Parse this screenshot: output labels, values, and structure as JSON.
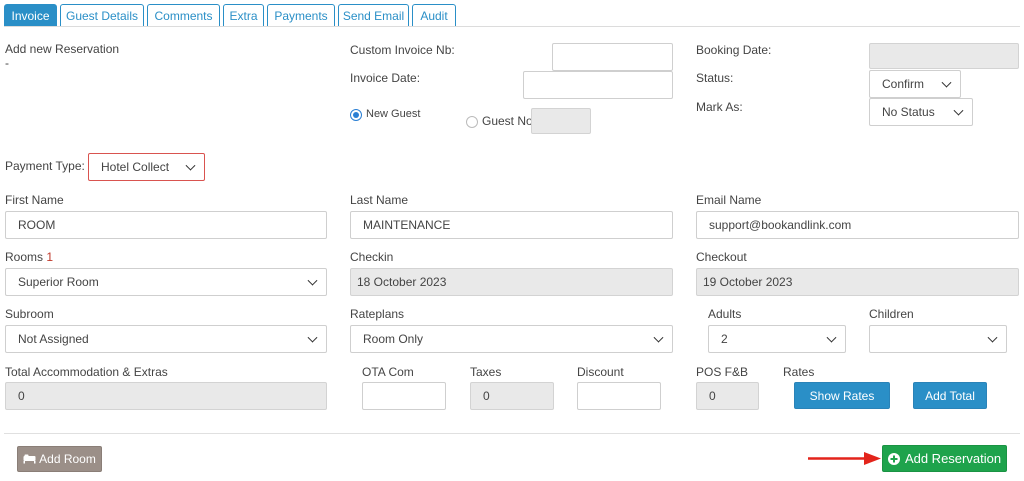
{
  "tabs": [
    "Invoice",
    "Guest Details",
    "Comments",
    "Extra",
    "Payments",
    "Send Email",
    "Audit"
  ],
  "header": {
    "title": "Add new Reservation",
    "subtitle": "-"
  },
  "invoice": {
    "custom_invoice_label": "Custom Invoice Nb:",
    "custom_invoice_value": "",
    "invoice_date_label": "Invoice Date:",
    "invoice_date_value": "",
    "new_guest_label": "New Guest",
    "guest_no_label": "Guest No",
    "guest_no_value": ""
  },
  "booking": {
    "booking_date_label": "Booking Date:",
    "booking_date_value": "",
    "status_label": "Status:",
    "status_value": "Confirm",
    "mark_as_label": "Mark As:",
    "mark_as_value": "No Status"
  },
  "payment": {
    "label": "Payment Type:",
    "value": "Hotel Collect"
  },
  "guest": {
    "first_name_label": "First Name",
    "first_name_value": "ROOM",
    "last_name_label": "Last Name",
    "last_name_value": "MAINTENANCE",
    "email_label": "Email Name",
    "email_value": "support@bookandlink.com"
  },
  "stay": {
    "rooms_label": "Rooms",
    "rooms_count": "1",
    "rooms_value": "Superior Room",
    "checkin_label": "Checkin",
    "checkin_value": "18 October 2023",
    "checkout_label": "Checkout",
    "checkout_value": "19 October 2023",
    "subroom_label": "Subroom",
    "subroom_value": "Not Assigned",
    "rateplans_label": "Rateplans",
    "rateplans_value": "Room Only",
    "adults_label": "Adults",
    "adults_value": "2",
    "children_label": "Children",
    "children_value": ""
  },
  "totals": {
    "total_label": "Total Accommodation & Extras",
    "total_value": "0",
    "ota_label": "OTA Com",
    "ota_value": "",
    "taxes_label": "Taxes",
    "taxes_value": "0",
    "discount_label": "Discount",
    "discount_value": "",
    "pos_label": "POS F&B",
    "pos_value": "0",
    "rates_label": "Rates"
  },
  "buttons": {
    "show_rates": "Show Rates",
    "add_total": "Add Total",
    "add_room": "Add Room",
    "add_reservation": "Add Reservation"
  },
  "colors": {
    "accent": "#2a8fc7",
    "green": "#1ea34c",
    "arrow": "#e3241b",
    "error_border": "#d9534f"
  }
}
